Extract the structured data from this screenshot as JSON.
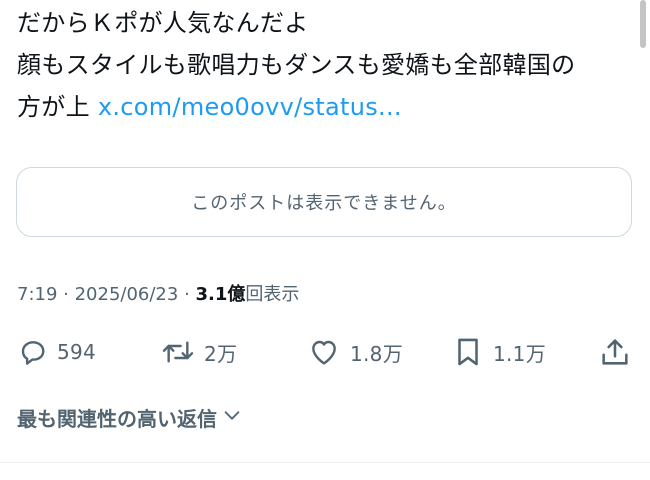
{
  "tweet": {
    "lines": [
      "だからＫポが人気なんだよ",
      "顔もスタイルも歌唱力もダンスも愛嬌も全部韓国の"
    ],
    "last_line_prefix": "方が上 ",
    "link_text": "x.com/meo0ovv/status..."
  },
  "quote_card": {
    "message": "このポストは表示できません。"
  },
  "meta": {
    "time": "7:19",
    "separator": " · ",
    "date": "2025/06/23",
    "views_count": "3.1億",
    "views_label": "回表示"
  },
  "actions": {
    "reply": {
      "icon": "reply-icon",
      "count": "594"
    },
    "repost": {
      "icon": "repost-icon",
      "count": "2万"
    },
    "like": {
      "icon": "heart-icon",
      "count": "1.8万"
    },
    "bookmark": {
      "icon": "bookmark-icon",
      "count": "1.1万"
    },
    "share": {
      "icon": "share-icon"
    }
  },
  "replies": {
    "sort_label": "最も関連性の高い返信"
  },
  "colors": {
    "text": "#0f1419",
    "secondary": "#536471",
    "link": "#1d9bf0",
    "border": "#cfd9de"
  }
}
